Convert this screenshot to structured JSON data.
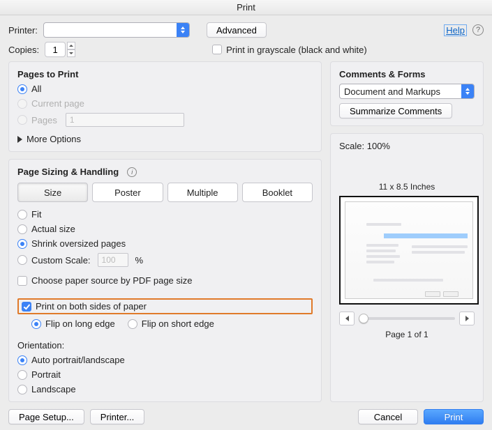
{
  "title": "Print",
  "printer_label": "Printer:",
  "printer_value": "",
  "advanced_btn": "Advanced",
  "help_link": "Help",
  "copies_label": "Copies:",
  "copies_value": "1",
  "grayscale_label": "Print in grayscale (black and white)",
  "pages_to_print": {
    "title": "Pages to Print",
    "all": "All",
    "current": "Current page",
    "pages_label": "Pages",
    "pages_value": "1",
    "more_options": "More Options"
  },
  "sizing": {
    "title": "Page Sizing & Handling",
    "size": "Size",
    "poster": "Poster",
    "multiple": "Multiple",
    "booklet": "Booklet",
    "fit": "Fit",
    "actual": "Actual size",
    "shrink": "Shrink oversized pages",
    "custom_label": "Custom Scale:",
    "custom_value": "100",
    "percent": "%",
    "choose_source": "Choose paper source by PDF page size"
  },
  "both_sides_label": "Print on both sides of paper",
  "flip_long": "Flip on long edge",
  "flip_short": "Flip on short edge",
  "orientation": {
    "title": "Orientation:",
    "auto": "Auto portrait/landscape",
    "portrait": "Portrait",
    "landscape": "Landscape"
  },
  "comments": {
    "title": "Comments & Forms",
    "selected": "Document and Markups",
    "summarize_btn": "Summarize Comments"
  },
  "preview": {
    "scale_label": "Scale: 100%",
    "dimensions": "11 x 8.5 Inches",
    "page_indicator": "Page 1 of 1"
  },
  "footer": {
    "page_setup": "Page Setup...",
    "printer_btn": "Printer...",
    "cancel": "Cancel",
    "print": "Print"
  }
}
